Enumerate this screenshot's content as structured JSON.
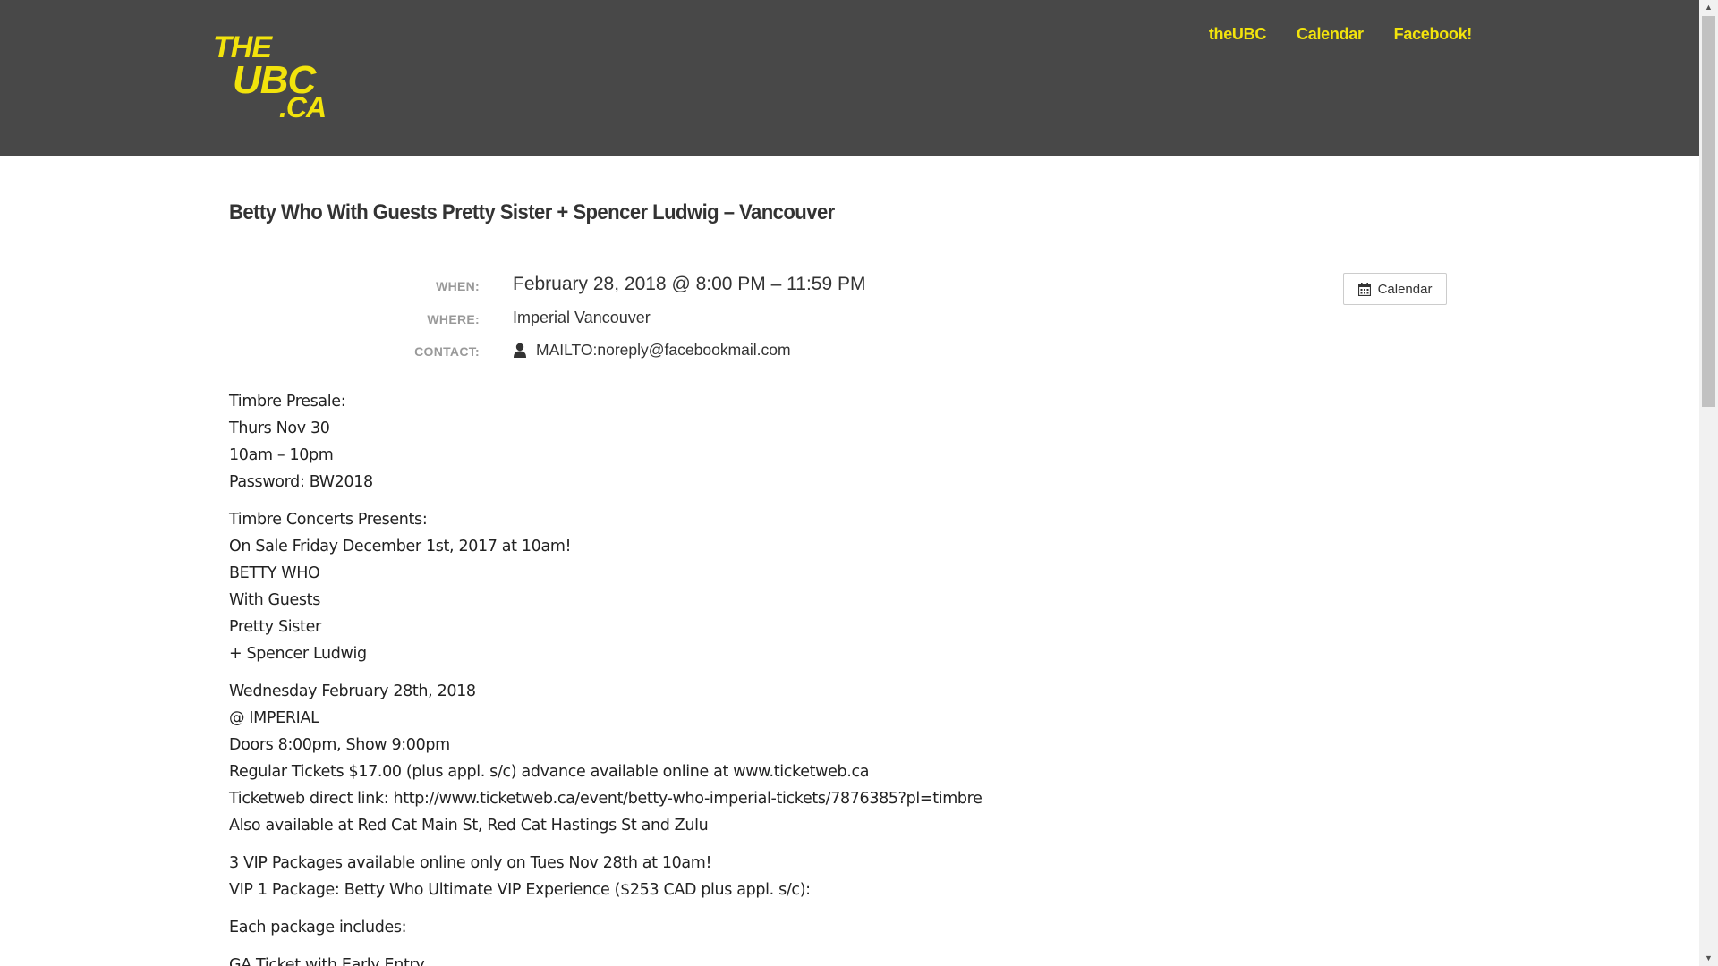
{
  "header": {
    "logo": {
      "line1": "THE",
      "line2": "UBC",
      "line3": ".CA"
    },
    "nav": [
      {
        "label": "theUBC"
      },
      {
        "label": "Calendar"
      },
      {
        "label": "Facebook!"
      }
    ]
  },
  "event": {
    "title": "Betty Who With Guests Pretty Sister + Spencer Ludwig – Vancouver",
    "when_label": "WHEN:",
    "when_value": "February 28, 2018 @ 8:00 PM – 11:59 PM",
    "where_label": "WHERE:",
    "where_value": "Imperial Vancouver",
    "contact_label": "CONTACT:",
    "contact_value": "MAILTO:noreply@facebookmail.com",
    "calendar_button": "Calendar"
  },
  "description": {
    "p1": [
      "Timbre Presale:",
      "Thurs Nov 30",
      "10am – 10pm",
      "Password: BW2018"
    ],
    "p2": [
      "Timbre Concerts Presents:",
      "On Sale Friday December 1st, 2017 at 10am!",
      "BETTY WHO",
      "With Guests",
      "Pretty Sister",
      "+ Spencer Ludwig"
    ],
    "p3": [
      "Wednesday February 28th, 2018",
      "@ IMPERIAL",
      "Doors 8:00pm, Show 9:00pm",
      "Regular Tickets $17.00 (plus appl. s/c) advance available online at www.ticketweb.ca",
      "Ticketweb direct link: http://www.ticketweb.ca/event/betty-who-imperial-tickets/7876385?pl=timbre",
      "Also available at Red Cat Main St, Red Cat Hastings St and Zulu"
    ],
    "p4": [
      "3 VIP Packages available online only on Tues Nov 28th at 10am!",
      "VIP 1 Package: Betty Who Ultimate VIP Experience ($253 CAD plus appl. s/c):"
    ],
    "p5": [
      "Each package includes:"
    ],
    "p6": [
      "GA Ticket with Early Entry"
    ]
  },
  "colors": {
    "header_bg": "#484848",
    "accent_yellow": "#f2e30c",
    "label_gray": "#999999"
  },
  "icons": {
    "calendar": "calendar-icon",
    "contact": "user-icon"
  }
}
